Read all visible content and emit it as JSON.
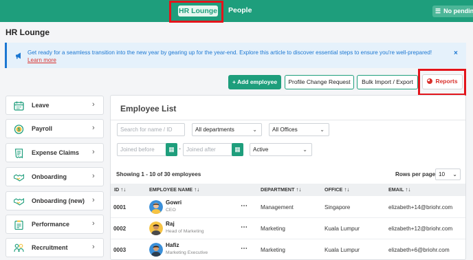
{
  "nav": {
    "tab_hr_lounge": "HR Lounge",
    "tab_people": "People",
    "pending_label": "No pending"
  },
  "page": {
    "title": "HR Lounge"
  },
  "banner": {
    "text": "Get ready for a seamless transition into the new year by gearing up for the year-end. Explore this article to discover essential steps to ensure you're well-prepared!",
    "link": "Learn more",
    "close": "×"
  },
  "actions": {
    "add_employee": "+ Add employee",
    "profile_change": "Profile Change Request",
    "bulk_import": "Bulk Import / Export",
    "reports": "Reports"
  },
  "sidebar": {
    "items": [
      {
        "label": "Leave",
        "icon": "calendar-icon"
      },
      {
        "label": "Payroll",
        "icon": "dollar-coin-icon"
      },
      {
        "label": "Expense Claims",
        "icon": "receipt-icon"
      },
      {
        "label": "Onboarding",
        "icon": "handshake-icon"
      },
      {
        "label": "Onboarding (new)",
        "icon": "handshake-icon"
      },
      {
        "label": "Performance",
        "icon": "clipboard-icon"
      },
      {
        "label": "Recruitment",
        "icon": "people-icon"
      }
    ]
  },
  "employee_list": {
    "title": "Employee List",
    "search_placeholder": "Search for name / ID",
    "department_select": "All departments",
    "office_select": "All Offices",
    "joined_before_placeholder": "Joined before",
    "joined_after_placeholder": "Joined after",
    "status_select": "Active",
    "showing": "Showing 1 - 10 of 30 employees",
    "rows_per_page_label": "Rows per page",
    "rows_per_page_value": "10",
    "columns": {
      "id": "ID",
      "name": "EMPLOYEE NAME",
      "department": "DEPARTMENT",
      "office": "OFFICE",
      "email": "EMAIL"
    },
    "rows": [
      {
        "id": "0001",
        "name": "Gowri",
        "title": "CEO",
        "department": "Management",
        "office": "Singapore",
        "email": "elizabeth+14@briohr.com"
      },
      {
        "id": "0002",
        "name": "Raj",
        "title": "Head of Marketing",
        "department": "Marketing",
        "office": "Kuala Lumpur",
        "email": "elizabeth+12@briohr.com"
      },
      {
        "id": "0003",
        "name": "Hafiz",
        "title": "Marketing Executive",
        "department": "Marketing",
        "office": "Kuala Lumpur",
        "email": "elizabeth+6@briohr.com"
      }
    ]
  },
  "colors": {
    "brand_green": "#1e9e7c",
    "info_blue": "#1b77d2",
    "alert_red": "#d9302b",
    "highlight_red": "#e3141b"
  }
}
